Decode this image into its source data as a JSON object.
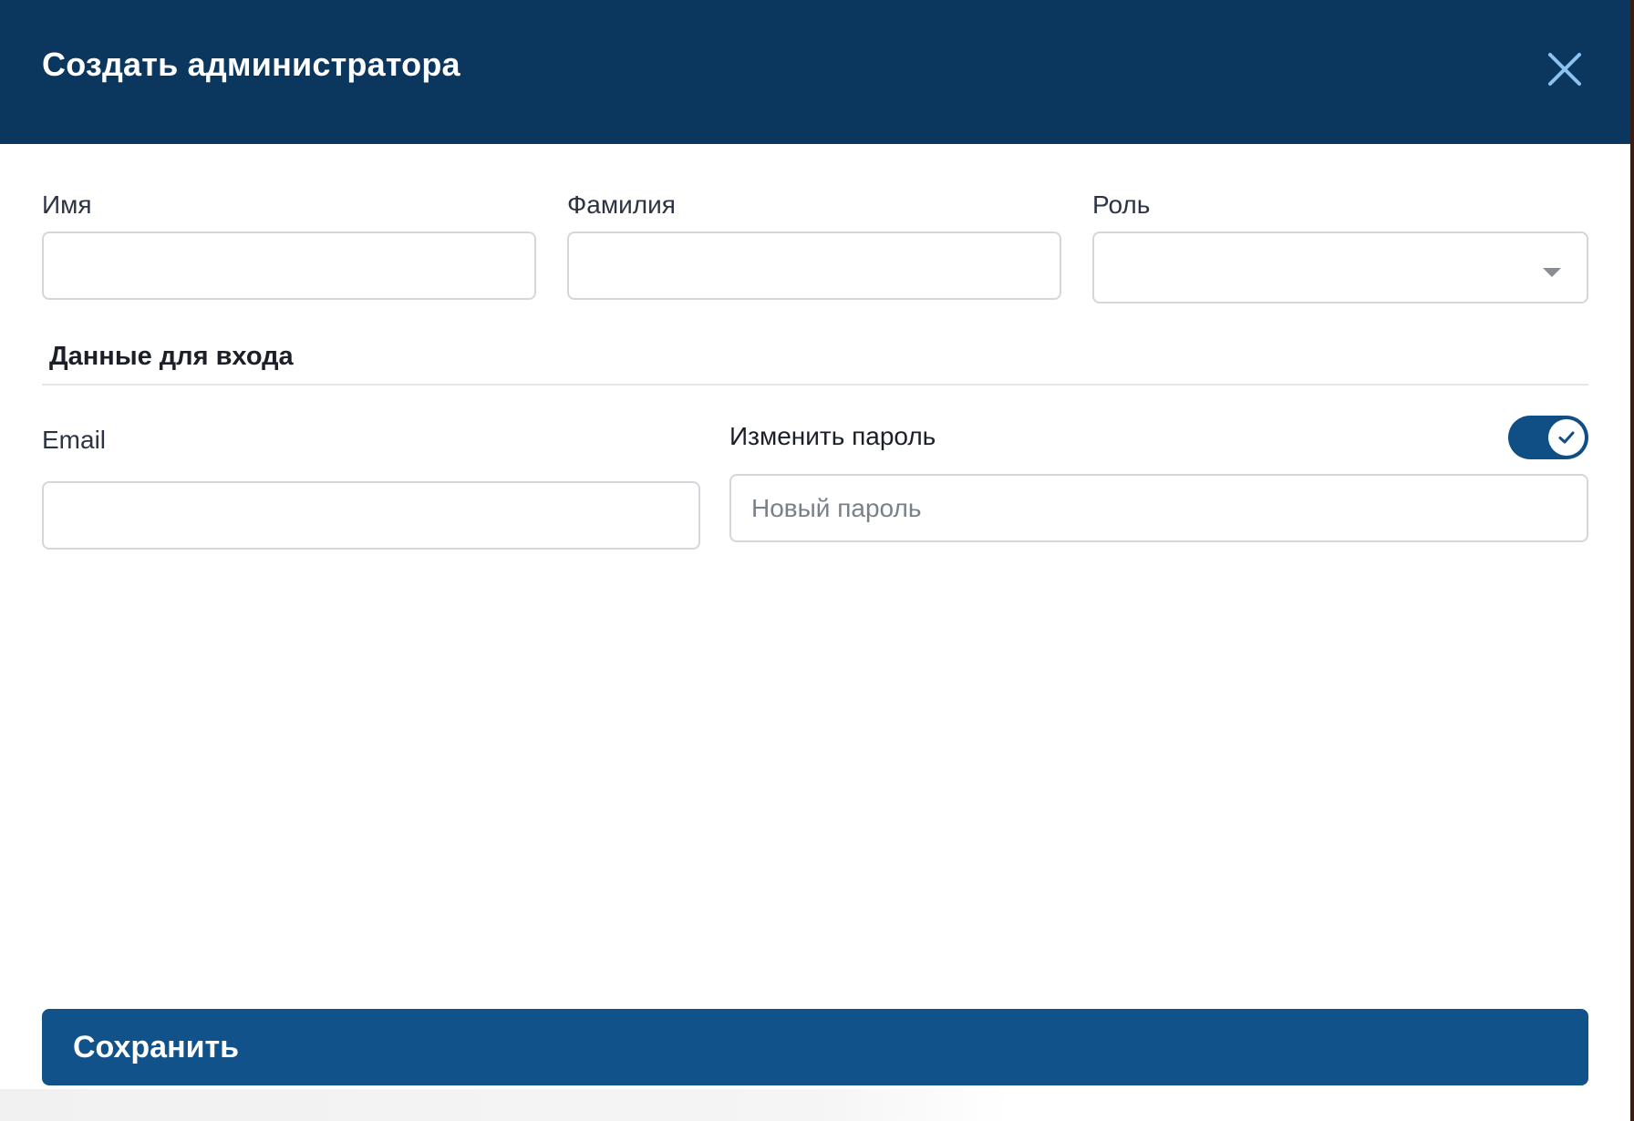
{
  "modal": {
    "title": "Создать администратора"
  },
  "form": {
    "first_name": {
      "label": "Имя",
      "value": ""
    },
    "last_name": {
      "label": "Фамилия",
      "value": ""
    },
    "role": {
      "label": "Роль",
      "value": ""
    },
    "login_section_title": "Данные для входа",
    "email": {
      "label": "Email",
      "value": ""
    },
    "change_password": {
      "label": "Изменить пароль",
      "enabled": true,
      "placeholder": "Новый пароль",
      "value": ""
    },
    "save_label": "Сохранить"
  },
  "colors": {
    "header_bg": "#0b365e",
    "accent": "#11528a",
    "close_icon": "#8cc3f2"
  }
}
